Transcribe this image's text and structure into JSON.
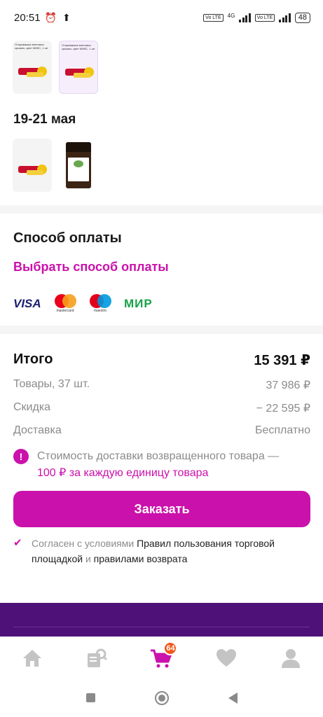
{
  "status": {
    "time": "20:51",
    "net_label": "4G",
    "volte": "Vo LTE",
    "battery": "48"
  },
  "delivery": {
    "thumb_caption_1": "Открывашка винтовых крышек, цвет МИКС, 1 шт",
    "thumb_caption_2": "Открывашка винтовых крышек, цвет МИКС, 1 шт",
    "date": "19-21 мая"
  },
  "payment": {
    "title": "Способ оплаты",
    "choose": "Выбрать способ оплаты",
    "visa": "VISA",
    "mastercard": "mastercard",
    "maestro": "maestro",
    "mir": "МИР"
  },
  "summary": {
    "title": "Итого",
    "total": "15 391 ₽",
    "goods_label": "Товары, 37 шт.",
    "goods_value": "37 986 ₽",
    "discount_label": "Скидка",
    "discount_value": "− 22 595 ₽",
    "delivery_label": "Доставка",
    "delivery_value": "Бесплатно",
    "notice_text": "Стоимость доставки возвращенного товара —",
    "notice_highlight": "100 ₽ за каждую единицу товара",
    "order_button": "Заказать",
    "agree_prefix": "Согласен с условиями",
    "agree_rules": "Правил пользования торговой площадкой",
    "agree_and": "и",
    "agree_return": "правилами возврата"
  },
  "tabbar": {
    "cart_count": "64"
  },
  "colors": {
    "accent": "#cb11ab",
    "band": "#4d1177",
    "badge": "#f2581c"
  },
  "icons": [
    "alarm-icon",
    "upload-icon",
    "signal-icon",
    "battery-icon",
    "home-icon",
    "catalog-icon",
    "cart-icon",
    "heart-icon",
    "profile-icon",
    "checkmark-icon",
    "info-icon"
  ]
}
